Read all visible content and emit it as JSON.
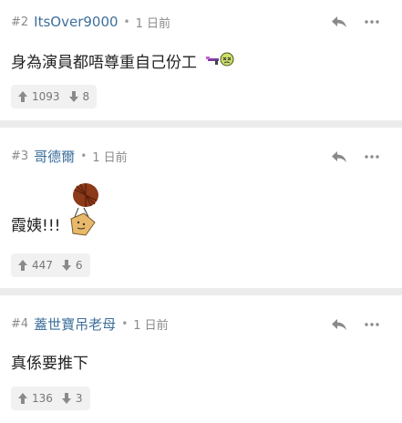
{
  "posts": [
    {
      "number": "#2",
      "username": "ItsOver9000",
      "separator": "•",
      "time": "1 日前",
      "content": "身為演員都唔尊重自己份工",
      "upvotes": "1093",
      "downvotes": "8"
    },
    {
      "number": "#3",
      "username": "哥德爾",
      "separator": "•",
      "time": "1 日前",
      "content": "霞姨!!!",
      "upvotes": "447",
      "downvotes": "6"
    },
    {
      "number": "#4",
      "username": "蓋世寶吊老母",
      "separator": "•",
      "time": "1 日前",
      "content": "真係要推下",
      "upvotes": "136",
      "downvotes": "3"
    }
  ],
  "icons": {
    "reply": "reply-icon",
    "more": "more-icon",
    "upvote": "up-arrow-icon",
    "downvote": "down-arrow-icon",
    "emoji_gun": "gun-smiley-emoji",
    "emoji_fan": "fan-dancer-emoji"
  },
  "colors": {
    "username": "#3e6f9c",
    "separator_band": "#ececec",
    "vote_bg": "#f1f1f1"
  }
}
